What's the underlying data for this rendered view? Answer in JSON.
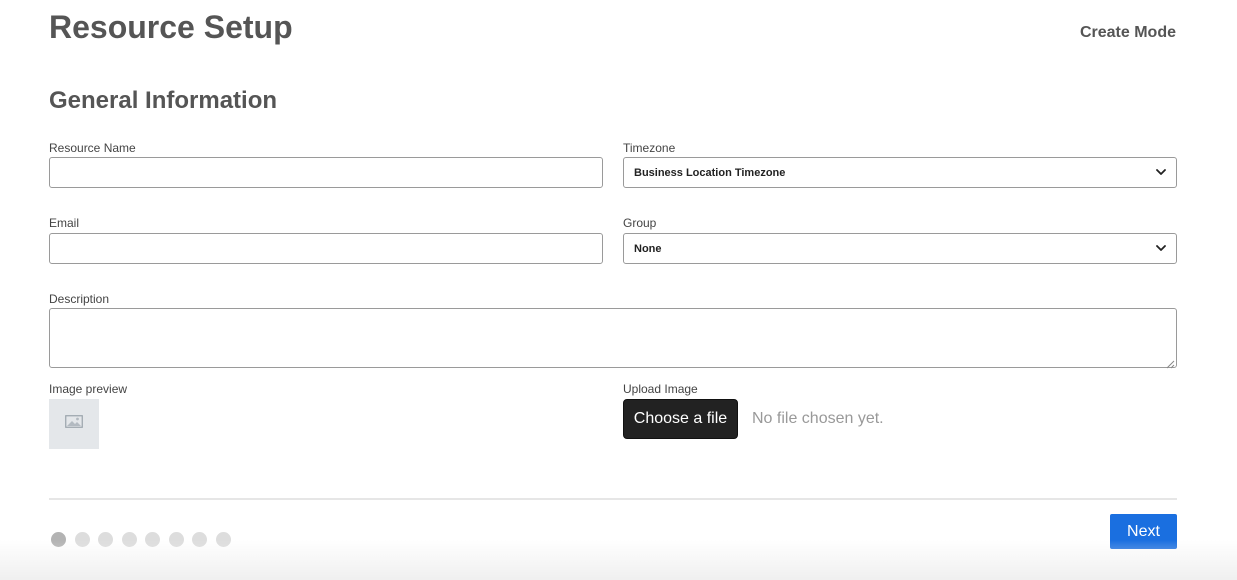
{
  "header": {
    "title": "Resource Setup",
    "mode": "Create Mode"
  },
  "section": {
    "title": "General Information"
  },
  "fields": {
    "resource_name": {
      "label": "Resource Name",
      "value": ""
    },
    "timezone": {
      "label": "Timezone",
      "selected": "Business Location Timezone"
    },
    "email": {
      "label": "Email",
      "value": ""
    },
    "group": {
      "label": "Group",
      "selected": "None"
    },
    "description": {
      "label": "Description",
      "value": ""
    },
    "image_preview": {
      "label": "Image preview",
      "icon": "image-placeholder-icon"
    },
    "upload_image": {
      "label": "Upload Image",
      "button_label": "Choose a file",
      "status": "No file chosen yet."
    }
  },
  "stepper": {
    "total_steps": 8,
    "current_step": 1
  },
  "footer": {
    "next_label": "Next"
  },
  "colors": {
    "primary": "#1a6fe0",
    "file_button": "#222222",
    "text": "#555555"
  }
}
